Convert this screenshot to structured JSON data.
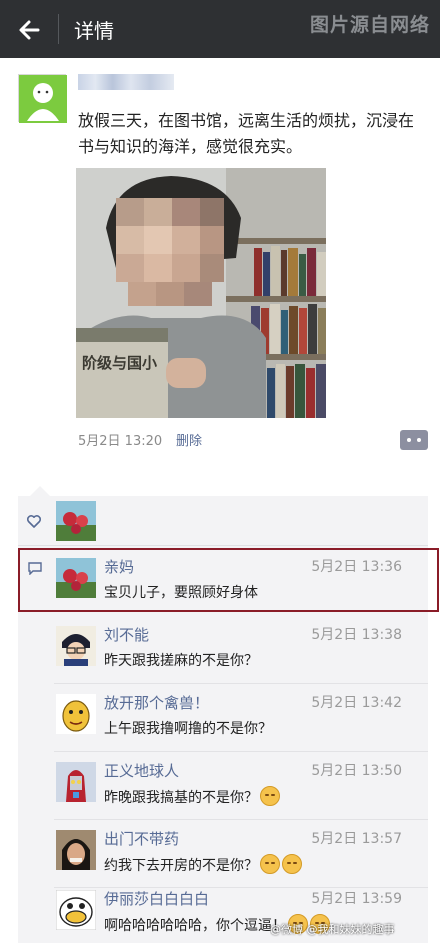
{
  "header": {
    "title": "详情",
    "watermark": "图片源自网络"
  },
  "post": {
    "text": "放假三天，在图书馆，远离生活的烦扰，沉浸在书与知识的海洋，感觉很充实。",
    "time": "5月2日 13:20",
    "delete_label": "删除",
    "photo_book_text": "阶级与国小"
  },
  "comments": [
    {
      "name": "亲妈",
      "time": "5月2日 13:36",
      "text": "宝贝儿子，要照顾好身体"
    },
    {
      "name": "刘不能",
      "time": "5月2日 13:38",
      "text": "昨天跟我搓麻的不是你？"
    },
    {
      "name": "放开那个禽兽！",
      "time": "5月2日 13:42",
      "text": "上午跟我撸啊撸的不是你？"
    },
    {
      "name": "正义地球人",
      "time": "5月2日 13:50",
      "text": "昨晚跟我搞基的不是你？"
    },
    {
      "name": "出门不带药",
      "time": "5月2日 13:57",
      "text": "约我下去开房的不是你？"
    },
    {
      "name": "伊丽莎白白白白",
      "time": "5月2日 13:59",
      "text": "啊哈哈哈哈哈哈，你个逗逼！"
    }
  ],
  "footer_watermark": "@微博 @我和妹妹的趣事",
  "colors": {
    "topbar": "#2e3033",
    "link": "#576b95",
    "highlight": "#8a1c28",
    "panel": "#f3f3f5"
  }
}
